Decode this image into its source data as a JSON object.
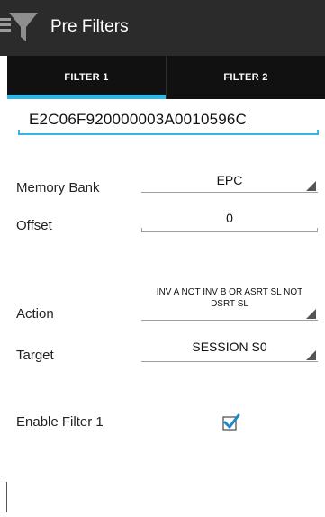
{
  "header": {
    "title": "Pre Filters",
    "menu_icon": "hamburger-icon",
    "app_icon": "filter-funnel-icon",
    "colors": {
      "bar": "#2b2b2b",
      "tab_bar": "#111111",
      "accent": "#33b5e5"
    }
  },
  "tabs": [
    {
      "label": "FILTER 1",
      "selected": true
    },
    {
      "label": "FILTER 2",
      "selected": false
    }
  ],
  "filter": {
    "hex_value": "E2C06F920000003A0010596C",
    "memory_bank": {
      "label": "Memory Bank",
      "value": "EPC"
    },
    "offset": {
      "label": "Offset",
      "value": "0"
    },
    "action": {
      "label": "Action",
      "value": "INV A NOT INV B OR ASRT SL NOT DSRT SL"
    },
    "target": {
      "label": "Target",
      "value": "SESSION S0"
    },
    "enable": {
      "label": "Enable Filter 1",
      "checked": true
    }
  }
}
